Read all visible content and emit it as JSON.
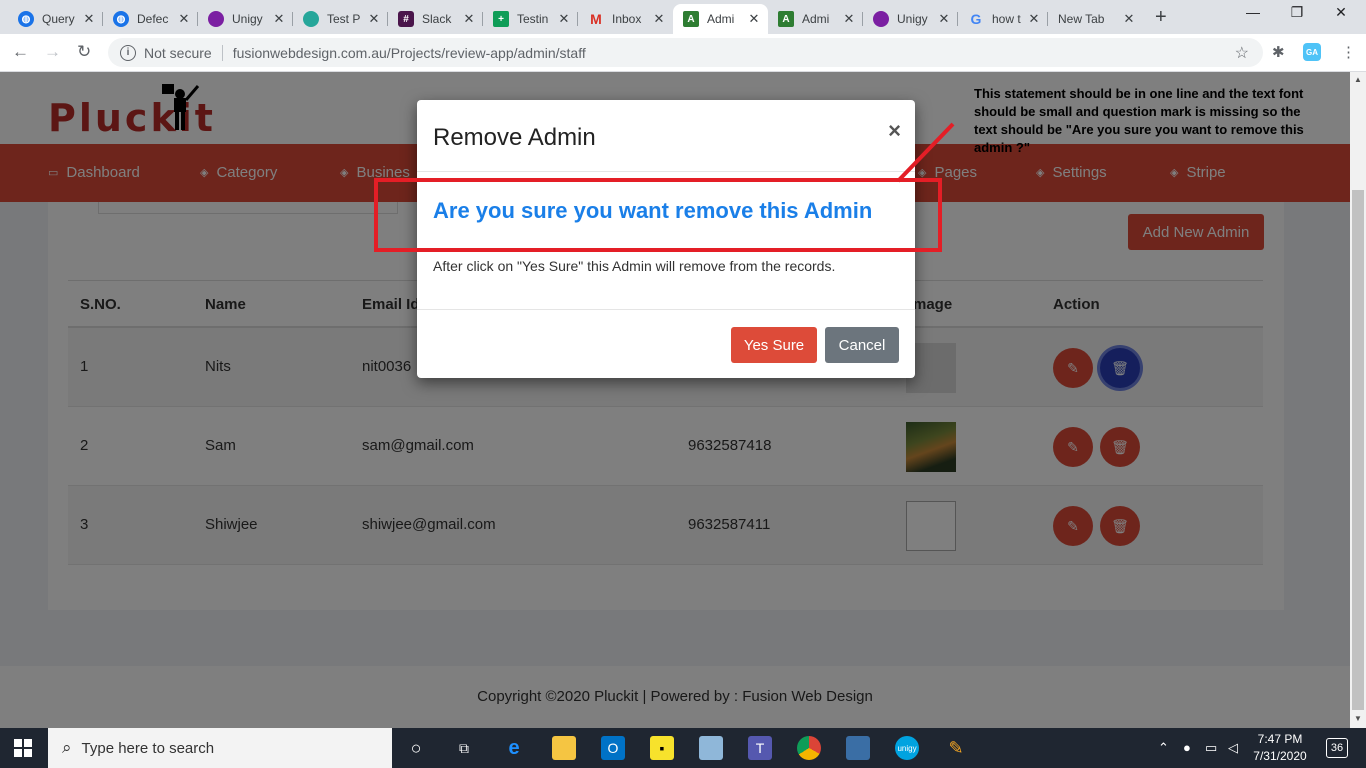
{
  "browser": {
    "tabs": [
      {
        "title": "Query",
        "color": "#1a73e8",
        "icon": "globe-icon"
      },
      {
        "title": "Defec",
        "color": "#1a73e8",
        "icon": "globe-icon"
      },
      {
        "title": "Unigy",
        "color": "#7b1fa2",
        "icon": "unigy-icon"
      },
      {
        "title": "Test P",
        "color": "#26a69a",
        "icon": "testp-icon"
      },
      {
        "title": "Slack",
        "color": "#4a154b",
        "icon": "slack-icon"
      },
      {
        "title": "Testin",
        "color": "#0f9d58",
        "icon": "sheets-icon"
      },
      {
        "title": "Inbox",
        "color": "#d93025",
        "icon": "gmail-icon"
      },
      {
        "title": "Admi",
        "color": "#2e7d32",
        "icon": "admin-icon"
      },
      {
        "title": "Admi",
        "color": "#2e7d32",
        "icon": "admin-icon"
      },
      {
        "title": "Unigy",
        "color": "#7b1fa2",
        "icon": "unigy-icon"
      },
      {
        "title": "how t",
        "color": "#4285f4",
        "icon": "google-icon"
      },
      {
        "title": "New Tab",
        "color": "",
        "icon": ""
      }
    ],
    "not_secure": "Not secure",
    "url": "fusionwebdesign.com.au/Projects/review-app/admin/staff",
    "ext_badge": "GA"
  },
  "site": {
    "logo": "Pluckit",
    "menu": [
      "Dashboard",
      "Category",
      "Busines",
      "Pages",
      "Settings",
      "Stripe"
    ],
    "add_button": "Add New Admin",
    "table": {
      "headers": [
        "S.NO.",
        "Name",
        "Email Id",
        "mage",
        "Action"
      ],
      "rows": [
        {
          "sno": "1",
          "name": "Nits",
          "email": "nit0036",
          "phone": ""
        },
        {
          "sno": "2",
          "name": "Sam",
          "email": "sam@gmail.com",
          "phone": "9632587418"
        },
        {
          "sno": "3",
          "name": "Shiwjee",
          "email": "shiwjee@gmail.com",
          "phone": "9632587411"
        }
      ]
    },
    "footer": "Copyright ©2020 Pluckit | Powered by : Fusion Web Design"
  },
  "modal": {
    "title": "Remove Admin",
    "close": "×",
    "question": "Are you sure you want remove this Admin",
    "message": "After click on \"Yes Sure\" this Admin will remove from the records.",
    "yes": "Yes Sure",
    "cancel": "Cancel"
  },
  "annotation": {
    "note": "This statement should be in one line and the text font should be small and question mark is missing so the text should be \"Are you sure you want to remove this admin ?\"",
    "color": "#e41e26"
  },
  "taskbar": {
    "search_placeholder": "Type here to search",
    "time": "7:47 PM",
    "date": "7/31/2020",
    "notifications": "36"
  }
}
